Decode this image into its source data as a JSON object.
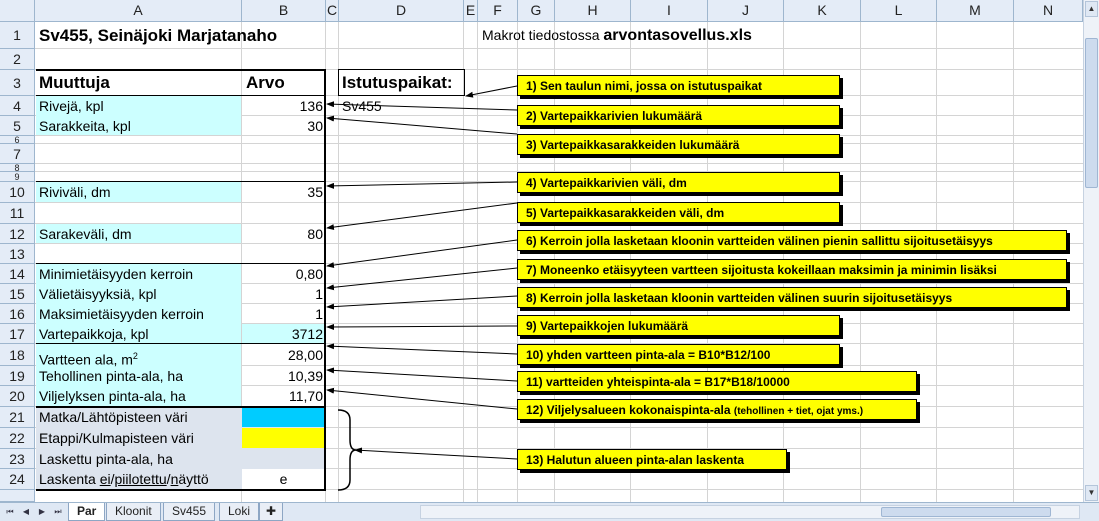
{
  "columns": [
    "A",
    "B",
    "C",
    "D",
    "E",
    "F",
    "G",
    "H",
    "I",
    "J",
    "K",
    "L",
    "M",
    "N"
  ],
  "rows": [
    "1",
    "2",
    "3",
    "4",
    "5",
    "6",
    "7",
    "8",
    "9",
    "10",
    "11",
    "12",
    "13",
    "14",
    "15",
    "16",
    "17",
    "18",
    "19",
    "20",
    "21",
    "22",
    "23",
    "24"
  ],
  "title": "Sv455, Seinäjoki Marjatanaho",
  "macro_note": {
    "prefix": "Makrot tiedostossa ",
    "file": "arvontasovellus.xls"
  },
  "headers": {
    "muuttuja": "Muuttuja",
    "arvo": "Arvo"
  },
  "istutus": {
    "label": "Istutuspaikat:",
    "value": "Sv455"
  },
  "params": [
    {
      "label": "Rivejä, kpl",
      "value": "136"
    },
    {
      "label": "Sarakkeita, kpl",
      "value": "30"
    },
    {
      "label": "Riviväli, dm",
      "value": "35"
    },
    {
      "label": "Sarakeväli, dm",
      "value": "80"
    },
    {
      "label": "Minimietäisyyden kerroin",
      "value": "0,80"
    },
    {
      "label": "Välietäisyyksiä, kpl",
      "value": "1"
    },
    {
      "label": "Maksimietäisyyden kerroin",
      "value": "1"
    },
    {
      "label": "Vartepaikkoja, kpl",
      "value": "3712"
    },
    {
      "label": "Vartteen ala, m",
      "sup": "2",
      "value": "28,00"
    },
    {
      "label": "Tehollinen pinta-ala, ha",
      "value": "10,39"
    },
    {
      "label": "Viljelyksen pinta-ala, ha",
      "value": "11,70"
    },
    {
      "label": "Matka/Lähtöpisteen väri",
      "value": ""
    },
    {
      "label": "Etappi/Kulmapisteen väri",
      "value": ""
    },
    {
      "label": "Laskettu pinta-ala, ha",
      "value": ""
    },
    {
      "label": "Laskenta ",
      "label_u1": "ei",
      "label_s1": "/",
      "label_u2": "piilotettu",
      "label_s2": "/",
      "label_u3": "n",
      "label_s3": "äyttö",
      "value": "e"
    }
  ],
  "callouts": [
    "1) Sen taulun nimi, jossa on istutuspaikat",
    "2) Vartepaikkarivien lukumäärä",
    "3) Vartepaikkasarakkeiden lukumäärä",
    "4) Vartepaikkarivien väli, dm",
    "5) Vartepaikkasarakkeiden väli, dm",
    "6) Kerroin jolla lasketaan kloonin vartteiden välinen pienin sallittu sijoitusetäisyys",
    "7) Moneenko etäisyyteen vartteen sijoitusta kokeillaan maksimin ja minimin lisäksi",
    "8) Kerroin jolla lasketaan kloonin vartteiden välinen suurin sijoitusetäisyys",
    "9) Vartepaikkojen lukumäärä",
    "10) yhden vartteen pinta-ala = B10*B12/100",
    "11) vartteiden yhteispinta-ala = B17*B18/10000",
    "12) Viljelysalueen kokonaispinta-ala",
    "13) Halutun alueen pinta-alan laskenta"
  ],
  "callout12_small": "(tehollinen + tiet, ojat yms.)",
  "tabs": [
    "Par",
    "Kloonit",
    "Sv455",
    "Loki"
  ],
  "colors": {
    "cyan_fill": "#00ccff",
    "yellow_fill": "#ffff00",
    "cell_cyan": "#ccffff",
    "callout": "#ffff00"
  }
}
